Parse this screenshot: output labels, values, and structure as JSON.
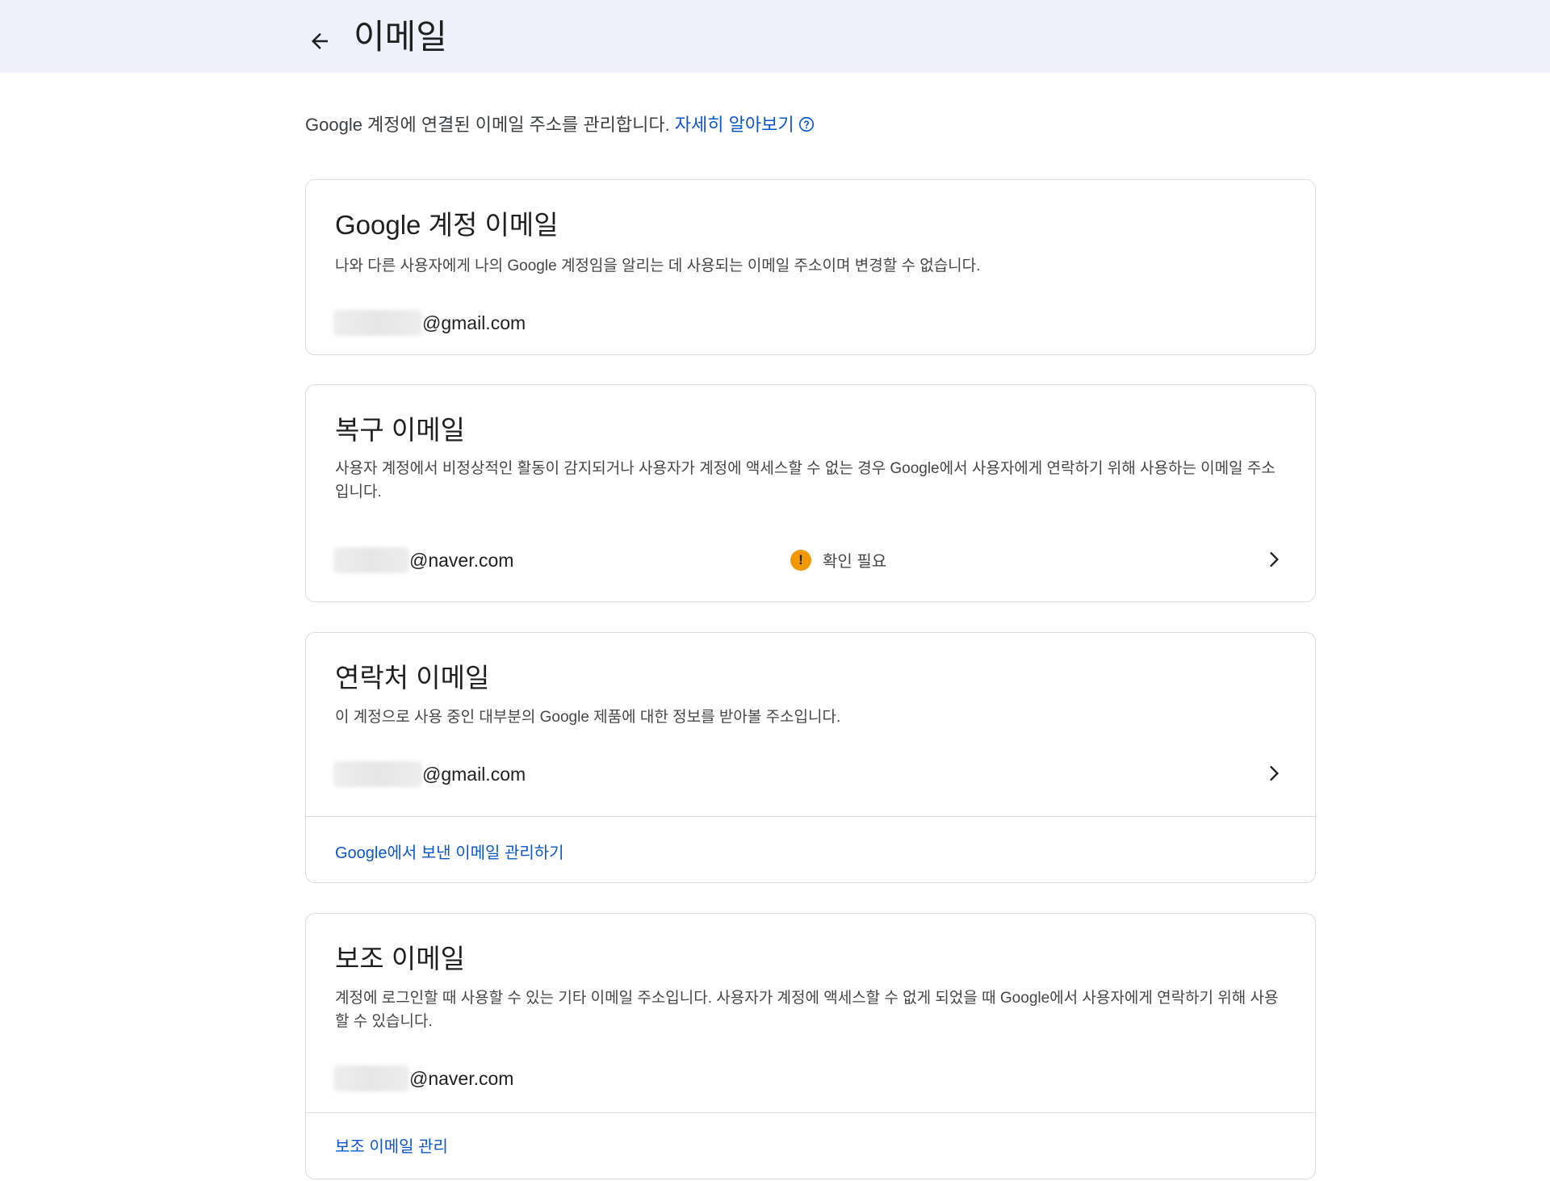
{
  "header": {
    "title": "이메일",
    "back_icon": "arrow-back-icon"
  },
  "intro": {
    "text": "Google 계정에 연결된 이메일 주소를 관리합니다. ",
    "link": "자세히 알아보기",
    "help_icon": "help-circle-icon"
  },
  "cards": {
    "account": {
      "title": "Google 계정 이메일",
      "description": "나와 다른 사용자에게 나의 Google 계정임을 알리는 데 사용되는 이메일 주소이며 변경할 수 없습니다.",
      "email_domain": "@gmail.com"
    },
    "recovery": {
      "title": "복구 이메일",
      "description": "사용자 계정에서 비정상적인 활동이 감지되거나 사용자가 계정에 액세스할 수 없는 경우 Google에서 사용자에게 연락하기 위해 사용하는 이메일 주소입니다.",
      "email_domain": "@naver.com",
      "status": "확인 필요",
      "status_icon": "warning-icon",
      "status_color": "#f29900"
    },
    "contact": {
      "title": "연락처 이메일",
      "description": "이 계정으로 사용 중인 대부분의 Google 제품에 대한 정보를 받아볼 주소입니다.",
      "email_domain": "@gmail.com",
      "link": "Google에서 보낸 이메일 관리하기"
    },
    "alternate": {
      "title": "보조 이메일",
      "description": "계정에 로그인할 때 사용할 수 있는 기타 이메일 주소입니다. 사용자가 계정에 액세스할 수 없게 되었을 때 Google에서 사용자에게 연락하기 위해 사용할 수 있습니다.",
      "email_domain": "@naver.com",
      "link": "보조 이메일 관리"
    }
  },
  "colors": {
    "header_bg": "#eef1f9",
    "link": "#0b57d0",
    "border": "#dadce0"
  }
}
